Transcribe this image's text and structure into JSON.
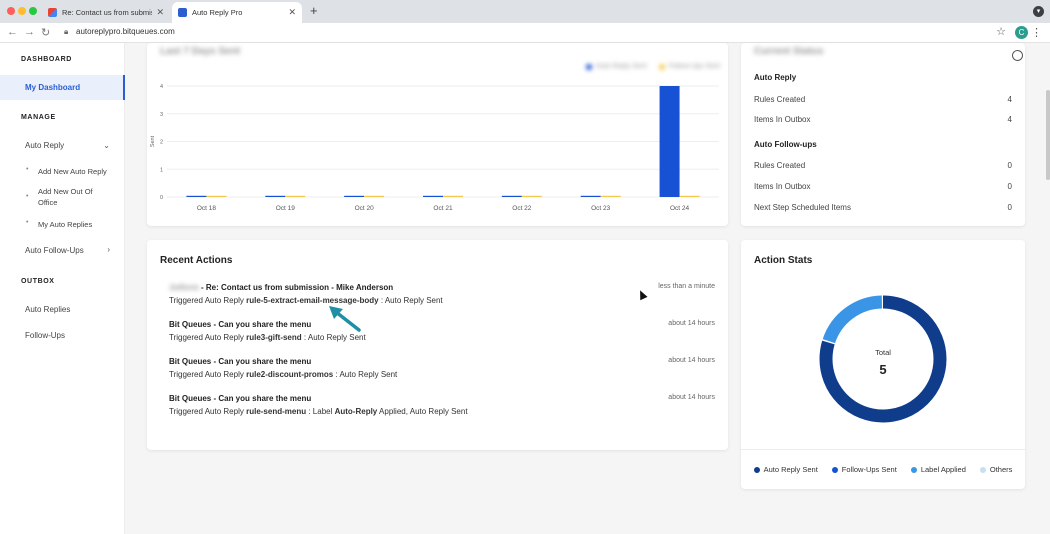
{
  "browser": {
    "tabs": [
      {
        "title": "Re: Contact us from submissio",
        "active": false
      },
      {
        "title": "Auto Reply Pro",
        "active": true
      }
    ],
    "url": "autoreplypro.bitqueues.com",
    "profile_initial": "C"
  },
  "sidebar": {
    "section_dashboard": "DASHBOARD",
    "my_dashboard": "My Dashboard",
    "section_manage": "MANAGE",
    "auto_reply": "Auto Reply",
    "auto_reply_items": [
      "Add New Auto Reply",
      "Add New Out Of Office",
      "My Auto Replies"
    ],
    "auto_followups": "Auto Follow-Ups",
    "section_outbox": "OUTBOX",
    "outbox_items": [
      "Auto Replies",
      "Follow-Ups"
    ]
  },
  "chart_card": {
    "title": "Last 7 Days Sent",
    "legend": [
      "Auto Reply Sent",
      "Follow-Ups Sent"
    ]
  },
  "chart_data": {
    "type": "bar",
    "categories": [
      "Oct 18",
      "Oct 19",
      "Oct 20",
      "Oct 21",
      "Oct 22",
      "Oct 23",
      "Oct 24"
    ],
    "series": [
      {
        "name": "Auto Reply Sent",
        "values": [
          0,
          0,
          0,
          0,
          0,
          0,
          4
        ],
        "color": "#1652d3"
      },
      {
        "name": "Follow-Ups Sent",
        "values": [
          0,
          0,
          0,
          0,
          0,
          0,
          0
        ],
        "color": "#f2c94c"
      }
    ],
    "ylabel": "Sent",
    "ylim": [
      0,
      4
    ],
    "yticks": [
      "0",
      "1",
      "2",
      "3",
      "4"
    ],
    "grid": true
  },
  "summary": {
    "title": "Current Status",
    "auto_reply": {
      "heading": "Auto Reply",
      "rows": [
        {
          "label": "Rules Created",
          "value": "4"
        },
        {
          "label": "Items In Outbox",
          "value": "4"
        }
      ]
    },
    "auto_followups": {
      "heading": "Auto Follow-ups",
      "rows": [
        {
          "label": "Rules Created",
          "value": "0"
        },
        {
          "label": "Items In Outbox",
          "value": "0"
        },
        {
          "label": "Next Step Scheduled Items",
          "value": "0"
        }
      ]
    }
  },
  "recent": {
    "title": "Recent Actions",
    "items": [
      {
        "sender": "Jotform",
        "subject": "- Re: Contact us from submission - Mike Anderson",
        "prefix": "Triggered Auto Reply",
        "rule": "rule-5-extract-email-message-body",
        "suffix": ": Auto Reply Sent",
        "time": "less than a minute"
      },
      {
        "sender": "",
        "subject": "Bit Queues - Can you share the menu",
        "prefix": "Triggered Auto Reply",
        "rule": "rule3-gift-send",
        "suffix": ": Auto Reply Sent",
        "time": "about 14 hours"
      },
      {
        "sender": "",
        "subject": "Bit Queues - Can you share the menu",
        "prefix": "Triggered Auto Reply",
        "rule": "rule2-discount-promos",
        "suffix": ": Auto Reply Sent",
        "time": "about 14 hours"
      },
      {
        "sender": "",
        "subject": "Bit Queues - Can you share the menu",
        "prefix": "Triggered Auto Reply",
        "rule": "rule-send-menu",
        "suffix": ": Label ",
        "label": "Auto-Reply",
        "suffix2": " Applied, Auto Reply Sent",
        "time": "about 14 hours"
      }
    ]
  },
  "stats": {
    "title": "Action Stats",
    "total_label": "Total",
    "total_value": "5",
    "legend": [
      {
        "name": "Auto Reply Sent",
        "color": "#0f3d8c"
      },
      {
        "name": "Follow-Ups Sent",
        "color": "#1652d3"
      },
      {
        "name": "Label Applied",
        "color": "#3a95e6"
      },
      {
        "name": "Others",
        "color": "#c6dff3"
      }
    ],
    "donut_values": [
      4,
      0,
      1,
      0
    ]
  },
  "colors": {
    "accent": "#2b5fd0",
    "arrow": "#1f8fa6"
  }
}
